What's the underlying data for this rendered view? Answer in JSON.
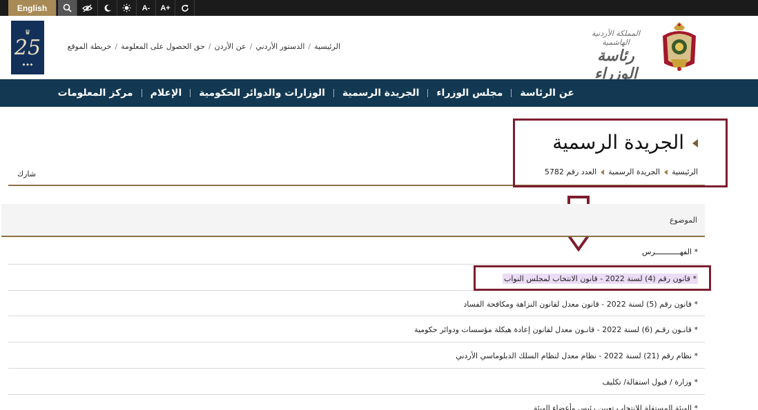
{
  "topbar": {
    "english_label": "English",
    "icons": [
      "search-icon",
      "hide-eye-icon",
      "moon-icon",
      "sun-icon",
      "font-decrease-icon",
      "font-increase-icon",
      "reset-icon"
    ],
    "font_decrease_label": "A-",
    "font_increase_label": "A+"
  },
  "header": {
    "toplinks": [
      "الرئيسية",
      "الدستور الأردني",
      "عن الأردن",
      "حق الحصول على المعلومة",
      "خريطة الموقع"
    ],
    "toplinks_sep": "/",
    "anniversary_number": "25",
    "brand_line1": "المملكة الأردنية الهاشمية",
    "brand_line2": "رئاسة الوزراء"
  },
  "nav": {
    "items": [
      "عن الرئاسة",
      "مجلس الوزراء",
      "الجريدة الرسمية",
      "الوزارات والدوائر الحكومية",
      "الإعلام",
      "مركز المعلومات"
    ]
  },
  "page": {
    "title": "الجريدة الرسمية",
    "breadcrumb": [
      "الرئيسية",
      "الجريدة الرسمية",
      "العدد رقم 5782"
    ],
    "share_label": "شارك"
  },
  "table": {
    "header": "الموضوع",
    "rows": [
      "* الفهـــــــــــرس",
      "* قانون رقم (4) لسنة 2022 - قانون الانتخاب لمجلس النواب",
      "* قانون رقم (5) لسنة 2022 - قانون معدل لقانون النزاهة ومكافحة الفساد",
      "* قانـون رقـم (6) لسنة 2022 - قانـون معدل لقانون إعادة هيكلة مؤسسات ودوائر حكومية",
      "* نظام رقم (21) لسنة 2022 - نظام معدل لنظام السلك الدبلوماسي الأردني",
      "* وزارة / قبول استقالة/ تكليف",
      "* الهيئة المستقلة للانتخاب تعيين رئيس وأعضاء الهيئة"
    ]
  },
  "colors": {
    "topbar_bg": "#1b1b1b",
    "english_bg": "#a88a56",
    "nav_bg": "#123852",
    "accent_gold": "#8b7046",
    "highlight_border": "#7b1e2e",
    "row_selection": "#ecdcf6"
  }
}
